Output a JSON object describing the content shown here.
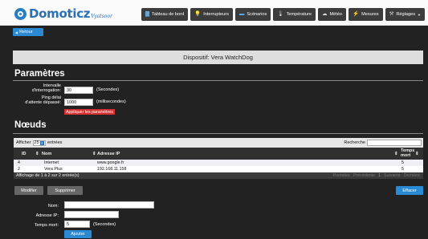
{
  "header": {
    "logo_text": "Domoticz",
    "logo_suffix": "Vyatsoor",
    "nav": [
      {
        "label": "Tableau de bord",
        "icon": "dashboard-icon",
        "glyph": "▇"
      },
      {
        "label": "Interrupteurs",
        "icon": "bulb-icon",
        "glyph": "💡"
      },
      {
        "label": "Scénarios",
        "icon": "scenes-icon",
        "glyph": "▬"
      },
      {
        "label": "Température",
        "icon": "thermometer-icon",
        "glyph": "🌡"
      },
      {
        "label": "Météo",
        "icon": "weather-icon",
        "glyph": "☁"
      },
      {
        "label": "Mesures",
        "icon": "utility-icon",
        "glyph": "⚡"
      },
      {
        "label": "Réglages",
        "icon": "settings-icon",
        "glyph": "⚒"
      }
    ]
  },
  "back_label": "Retour",
  "device_title": "Dispositif: Vera WatchDog",
  "params": {
    "heading": "Paramètres",
    "interval_label_1": "Intervalle",
    "interval_label_2": "d'interrogation:",
    "interval_value": "30",
    "interval_unit": "(Secondes)",
    "ping_label_1": "Ping délai",
    "ping_label_2": "d'attente dépassé:",
    "ping_value": "1000",
    "ping_unit": "(millisecondes)",
    "apply_label": "Appliquer les paramètres"
  },
  "nodes": {
    "heading": "Nœuds",
    "show_label": "Afficher",
    "page_size": "25",
    "entries_label": "entrées",
    "search_label": "Recherche",
    "columns": [
      "ID",
      "Nom",
      "Adresse IP",
      "Temps mort"
    ],
    "rows": [
      {
        "id": "4",
        "name": "Internet",
        "ip": "www.google.fr",
        "timeout": "5"
      },
      {
        "id": "2",
        "name": "Vera Plus",
        "ip": "192.168.11.158",
        "timeout": "5"
      }
    ],
    "info": "Affichage de 1 à 2 sur 2 entrée(s)",
    "pager": [
      "Première",
      "Précédente",
      "1",
      "Suivante",
      "Dernière"
    ]
  },
  "actions": {
    "modify_label": "Modifier",
    "delete_label": "Supprimer",
    "clear_label": "Effacer"
  },
  "form": {
    "name_label": "Nom:",
    "name_value": "",
    "ip_label": "Adresse IP:",
    "ip_value": "",
    "timeout_label": "Temps mort:",
    "timeout_value": "5",
    "timeout_unit": "(Secondes)",
    "add_label": "Ajouter"
  },
  "colors": {
    "accent": "#2a8ad4",
    "danger": "#d83030",
    "background": "#222222"
  }
}
